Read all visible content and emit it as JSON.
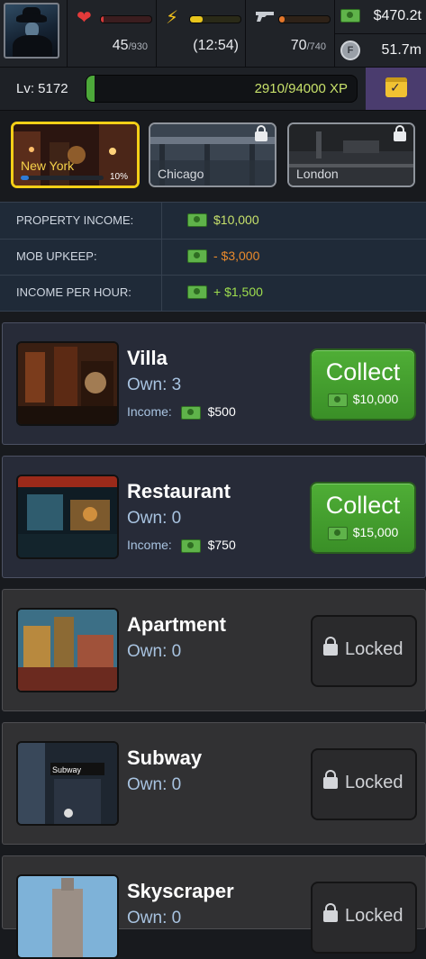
{
  "stats": {
    "health": {
      "value": "45",
      "max": "/930",
      "fill": 0.05
    },
    "energy": {
      "timer": "(12:54)",
      "fill": 0.25
    },
    "stamina": {
      "value": "70",
      "max": "/740",
      "fill": 0.1
    },
    "cash": "$470.2t",
    "coins": "51.7m"
  },
  "level": {
    "label": "Lv: 5172",
    "xp": "2910/94000 XP",
    "xp_fraction": 0.031
  },
  "cities": [
    {
      "name": "New York",
      "progress": "10%",
      "progress_fraction": 0.1,
      "locked": false
    },
    {
      "name": "Chicago",
      "locked": true
    },
    {
      "name": "London",
      "locked": true
    }
  ],
  "income": [
    {
      "label": "PROPERTY INCOME:",
      "amount": "$10,000",
      "color": "#c7e16b"
    },
    {
      "label": "MOB UPKEEP:",
      "amount": "- $3,000",
      "color": "#e98a2c"
    },
    {
      "label": "INCOME PER HOUR:",
      "amount": "+ $1,500",
      "color": "#9ede4e"
    }
  ],
  "properties": [
    {
      "name": "Villa",
      "own": "Own: 3",
      "income_label": "Income:",
      "income": "$500",
      "button": "Collect",
      "button_amount": "$10,000"
    },
    {
      "name": "Restaurant",
      "own": "Own: 0",
      "income_label": "Income:",
      "income": "$750",
      "button": "Collect",
      "button_amount": "$15,000"
    },
    {
      "name": "Apartment",
      "own": "Own: 0",
      "button": "Locked"
    },
    {
      "name": "Subway",
      "own": "Own: 0",
      "button": "Locked"
    },
    {
      "name": "Skyscraper",
      "own": "Own: 0",
      "button": "Locked"
    }
  ],
  "icons": {
    "health": "heart-icon",
    "energy": "lightning-icon",
    "stamina": "gun-icon",
    "cash": "cash-icon",
    "coin": "coin-icon",
    "calendar": "calendar-check-icon"
  }
}
